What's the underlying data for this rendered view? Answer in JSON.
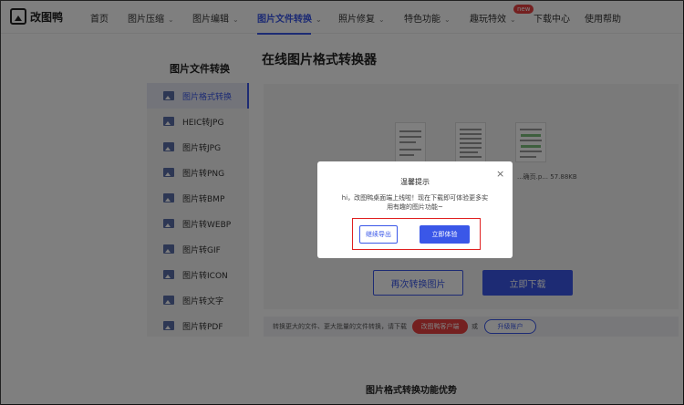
{
  "header": {
    "logo_text": "改图鸭",
    "new_badge": "new",
    "nav": [
      {
        "label": "首页",
        "caret": false
      },
      {
        "label": "图片压缩",
        "caret": true
      },
      {
        "label": "图片编辑",
        "caret": true
      },
      {
        "label": "图片文件转换",
        "caret": true,
        "active": true
      },
      {
        "label": "照片修复",
        "caret": true
      },
      {
        "label": "特色功能",
        "caret": true
      },
      {
        "label": "趣玩特效",
        "caret": true
      },
      {
        "label": "下载中心",
        "caret": false
      },
      {
        "label": "使用帮助",
        "caret": false
      }
    ]
  },
  "sidebar": {
    "title": "图片文件转换",
    "items": [
      {
        "label": "图片格式转换",
        "active": true
      },
      {
        "label": "HEIC转JPG"
      },
      {
        "label": "图片转JPG"
      },
      {
        "label": "图片转PNG"
      },
      {
        "label": "图片转BMP"
      },
      {
        "label": "图片转WEBP"
      },
      {
        "label": "图片转GIF"
      },
      {
        "label": "图片转ICON"
      },
      {
        "label": "图片转文字"
      },
      {
        "label": "图片转PDF"
      }
    ]
  },
  "main": {
    "title": "在线图片格式转换器",
    "file_meta": "...确页.p...  57.88KB",
    "again_button": "再次转换图片",
    "download_button": "立即下载",
    "tip_text": "转换更大的文件、更大批量的文件转换，请下载",
    "client_button": "改图鸭客户端",
    "tip_or": "或",
    "upgrade_button": "升级账户",
    "section_title": "图片格式转换功能优势"
  },
  "modal": {
    "title": "温馨提示",
    "close": "×",
    "body": "hi，改图鸭桌面端上线啦！现在下载即可体验更多实用有趣的图片功能~",
    "continue_button": "继续导出",
    "try_button": "立即体验"
  },
  "colors": {
    "accent": "#3a57e8",
    "danger": "#e84040"
  }
}
